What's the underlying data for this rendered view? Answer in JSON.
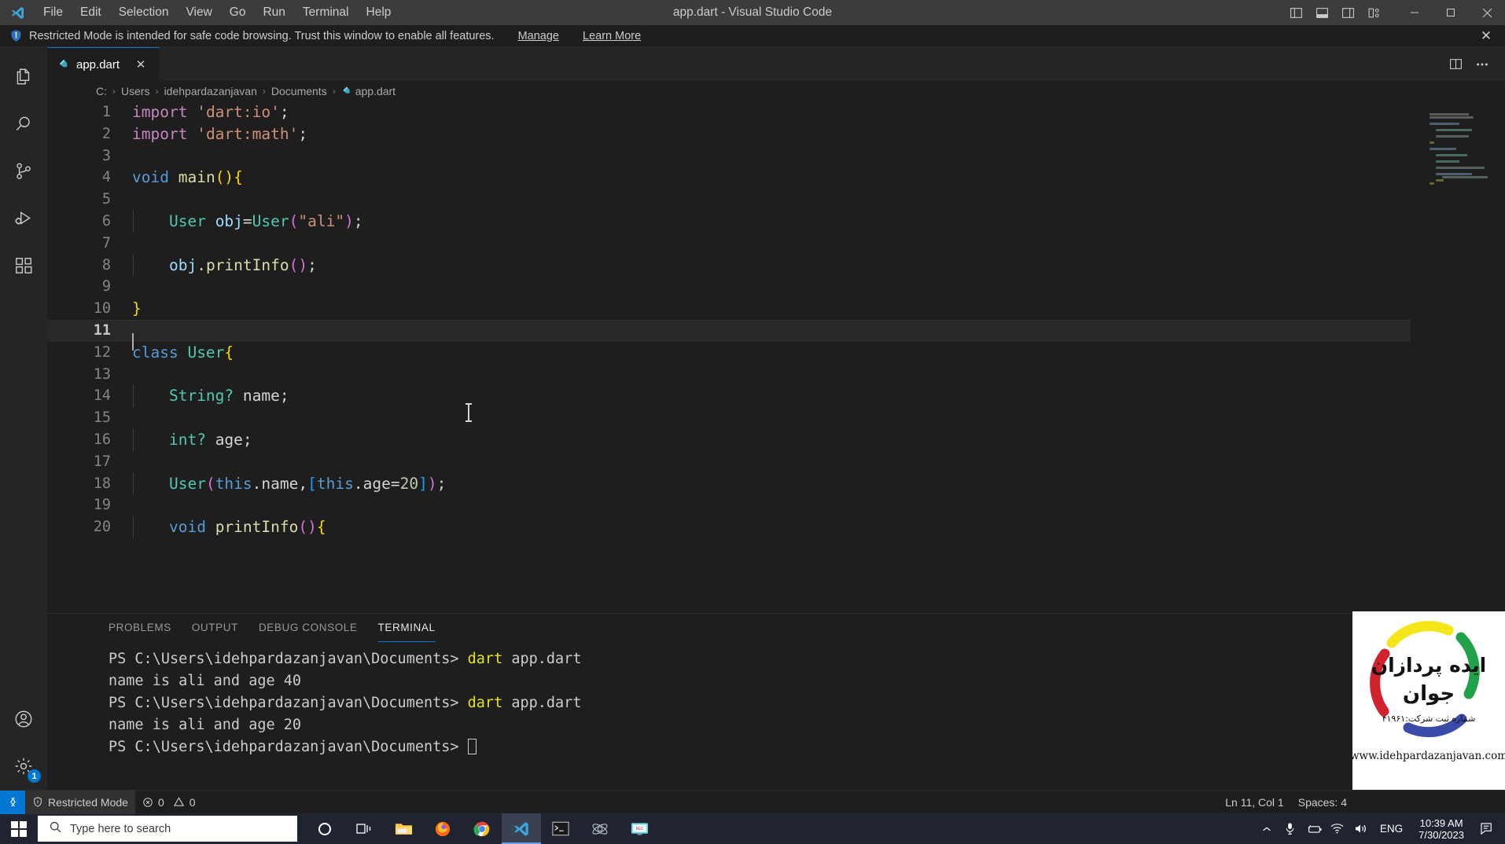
{
  "titlebar": {
    "window_title": "app.dart - Visual Studio Code",
    "menus": [
      "File",
      "Edit",
      "Selection",
      "View",
      "Go",
      "Run",
      "Terminal",
      "Help"
    ],
    "layout_buttons": [
      "toggle-primary-sidebar",
      "toggle-panel",
      "toggle-secondary-sidebar",
      "customize-layout"
    ],
    "window_controls": [
      "minimize",
      "maximize",
      "close"
    ]
  },
  "banner": {
    "message": "Restricted Mode is intended for safe code browsing. Trust this window to enable all features.",
    "manage_label": "Manage",
    "learn_more_label": "Learn More",
    "close_label": "✕"
  },
  "activitybar": {
    "items": [
      "explorer-icon",
      "search-icon",
      "source-control-icon",
      "run-debug-icon",
      "extensions-icon"
    ],
    "bottom_items": [
      "accounts-icon",
      "manage-settings-icon"
    ],
    "settings_badge": "1"
  },
  "editor": {
    "tab": {
      "label": "app.dart",
      "close_label": "✕",
      "icon": "dart-file-icon"
    },
    "actions": [
      "split-editor-icon",
      "more-actions-icon"
    ],
    "breadcrumb": [
      "C:",
      "Users",
      "idehpardazanjavan",
      "Documents",
      "app.dart"
    ],
    "breadcrumb_separator": "›",
    "active_line": 11,
    "lines": [
      {
        "n": 1,
        "text": "import 'dart:io';"
      },
      {
        "n": 2,
        "text": "import 'dart:math';"
      },
      {
        "n": 3,
        "text": ""
      },
      {
        "n": 4,
        "text": "void main(){"
      },
      {
        "n": 5,
        "text": ""
      },
      {
        "n": 6,
        "text": "    User obj=User(\"ali\");"
      },
      {
        "n": 7,
        "text": ""
      },
      {
        "n": 8,
        "text": "    obj.printInfo();"
      },
      {
        "n": 9,
        "text": ""
      },
      {
        "n": 10,
        "text": "}"
      },
      {
        "n": 11,
        "text": ""
      },
      {
        "n": 12,
        "text": "class User{"
      },
      {
        "n": 13,
        "text": ""
      },
      {
        "n": 14,
        "text": "    String? name;"
      },
      {
        "n": 15,
        "text": ""
      },
      {
        "n": 16,
        "text": "    int? age;"
      },
      {
        "n": 17,
        "text": ""
      },
      {
        "n": 18,
        "text": "    User(this.name,[this.age=20]);"
      },
      {
        "n": 19,
        "text": ""
      },
      {
        "n": 20,
        "text": "    void printInfo(){"
      }
    ]
  },
  "panel": {
    "tabs": [
      "PROBLEMS",
      "OUTPUT",
      "DEBUG CONSOLE",
      "TERMINAL"
    ],
    "active_tab": "TERMINAL",
    "terminal_lines": [
      {
        "prompt": "PS C:\\Users\\idehpardazanjavan\\Documents> ",
        "cmd": "dart",
        "args": " app.dart"
      },
      {
        "prompt": "",
        "output": "name is ali and age 40"
      },
      {
        "prompt": "PS C:\\Users\\idehpardazanjavan\\Documents> ",
        "cmd": "dart",
        "args": " app.dart"
      },
      {
        "prompt": "",
        "output": "name is ali and age 20"
      },
      {
        "prompt": "PS C:\\Users\\idehpardazanjavan\\Documents> ",
        "cursor": true
      }
    ]
  },
  "statusbar": {
    "remote_icon": "remote-window-icon",
    "trust_label": "Restricted Mode",
    "errors": "0",
    "warnings": "0",
    "position": "Ln 11, Col 1",
    "indentation": "Spaces: 4"
  },
  "watermark": {
    "line1": "ایده پردازان",
    "line2": "جوان",
    "registration": "شماره ثبت شرکت:۴۱۹۶۱",
    "url": "www.idehpardazanjavan.com",
    "colors": {
      "yellow": "#f5e61a",
      "green": "#22a14b",
      "blue": "#3b4ba8",
      "red": "#d0232c"
    }
  },
  "taskbar": {
    "start_label": "start-button",
    "search_placeholder": "Type here to search",
    "apps": [
      "cortana-icon",
      "task-view-icon",
      "file-explorer-icon",
      "firefox-icon",
      "chrome-icon",
      "vscode-icon",
      "terminal-icon",
      "electron-icon",
      "screen-recorder-icon"
    ],
    "active_app": "vscode-icon",
    "tray_icons": [
      "show-hidden-icons",
      "microphone-icon",
      "battery-icon",
      "wifi-icon",
      "volume-icon"
    ],
    "language": "ENG",
    "time": "10:39 AM",
    "date": "7/30/2023",
    "notification_icon": "action-center-icon"
  }
}
